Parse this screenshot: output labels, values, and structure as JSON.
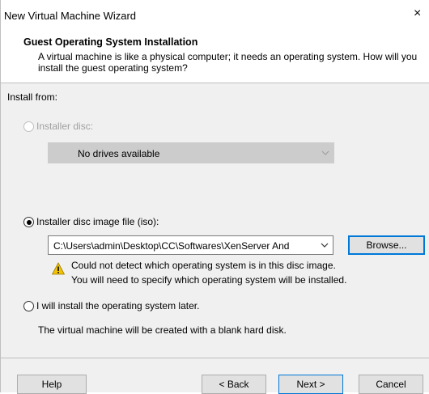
{
  "window": {
    "title": "New Virtual Machine Wizard",
    "close_glyph": "×"
  },
  "header": {
    "title": "Guest Operating System Installation",
    "description": "A virtual machine is like a physical computer; it needs an operating system. How will you install the guest operating system?"
  },
  "content": {
    "install_from_label": "Install from:",
    "option_disc": {
      "label": "Installer disc:",
      "selected": false,
      "enabled": false,
      "dropdown_value": "No drives available"
    },
    "option_iso": {
      "label": "Installer disc image file (iso):",
      "selected": true,
      "enabled": true,
      "path_value": "C:\\Users\\admin\\Desktop\\CC\\Softwares\\XenServer And",
      "browse_label": "Browse..."
    },
    "warning": {
      "icon": "warning-triangle-icon",
      "line1": "Could not detect which operating system is in this disc image.",
      "line2": "You will need to specify which operating system will be installed."
    },
    "option_later": {
      "label": "I will install the operating system later.",
      "selected": false,
      "enabled": true,
      "description": "The virtual machine will be created with a blank hard disk."
    }
  },
  "footer": {
    "help_label": "Help",
    "back_label": "< Back",
    "next_label": "Next >",
    "cancel_label": "Cancel"
  },
  "colors": {
    "accent": "#0078d7",
    "panel": "#f0f0f0",
    "warning": "#f2c200"
  }
}
